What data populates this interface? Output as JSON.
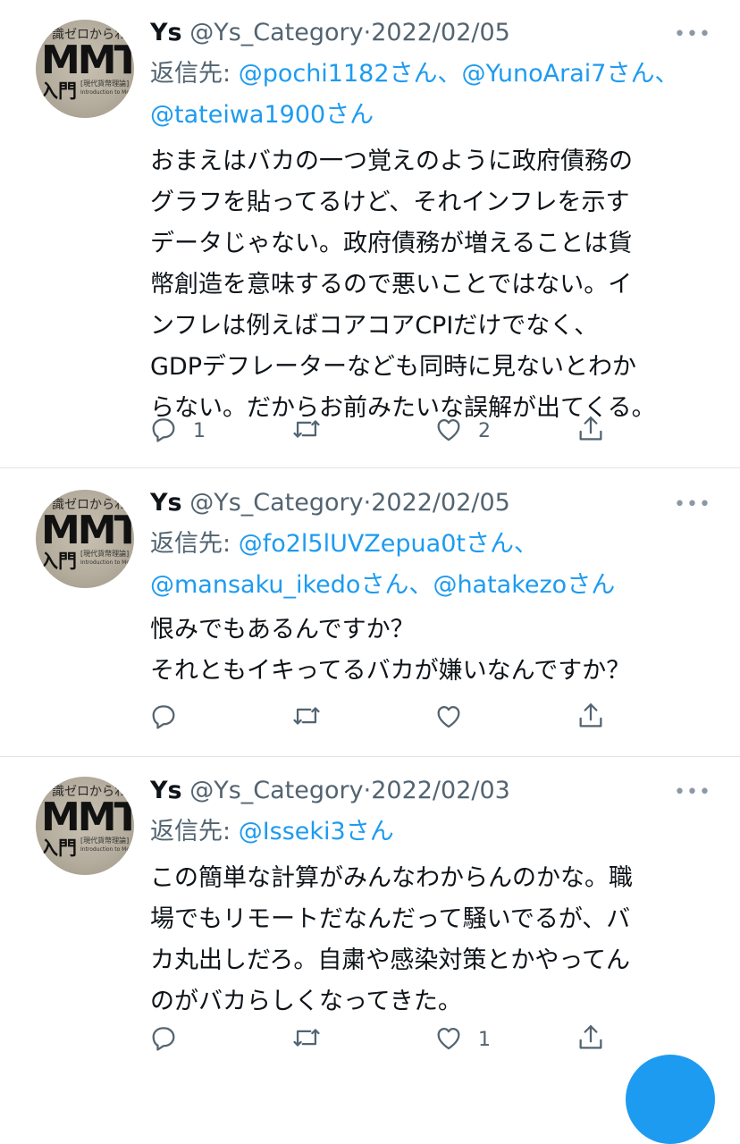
{
  "tweets": [
    {
      "name": "Ys",
      "handle": "@Ys_Category",
      "separator": "·",
      "date": "2022/02/05",
      "more": "•••",
      "reply_prefix": "返信先: ",
      "mentions": [
        "@pochi1182",
        "@YunoArai7",
        "@tateiwa1900"
      ],
      "mention_suffix": "さん",
      "body": "おまえはバカの一つ覚えのように政府債務の\nグラフを貼ってるけど、それインフレを示す\nデータじゃない。政府債務が増えることは貨\n幣創造を意味するので悪いことではない。イ\nンフレは例えばコアコアCPIだけでなく、\nGDPデフレーターなども同時に見ないとわか\nらない。だからお前みたいな誤解が出てくる。",
      "reply_count": "1",
      "retweet_count": "",
      "like_count": "2"
    },
    {
      "name": "Ys",
      "handle": "@Ys_Category",
      "separator": "·",
      "date": "2022/02/05",
      "more": "•••",
      "reply_prefix": "返信先: ",
      "mentions": [
        "@fo2l5lUVZepua0t",
        "@mansaku_ikedo",
        "@hatakezo"
      ],
      "mention_suffix": "さん",
      "body": "恨みでもあるんですか？\nそれともイキってるバカが嫌いなんですか？",
      "reply_count": "",
      "retweet_count": "",
      "like_count": ""
    },
    {
      "name": "Ys",
      "handle": "@Ys_Category",
      "separator": "·",
      "date": "2022/02/03",
      "more": "•••",
      "reply_prefix": "返信先: ",
      "mentions": [
        "@Isseki3"
      ],
      "mention_suffix": "さん",
      "body": "この簡単な計算がみんなわからんのかな。職\n場でもリモートだなんだって騒いでるが、バ\nカ丸出しだろ。自粛や感染対策とかやってん\nのがバカらしくなってきた。",
      "reply_count": "",
      "retweet_count": "",
      "like_count": "1"
    }
  ],
  "avatar": {
    "top_text": "識ゼロからわか",
    "title": "MMT",
    "subtitle": "入門",
    "series": "[現代貨幣理論]",
    "english": "Introduction to Modern Monetary Theory"
  },
  "icons": {
    "reply": "reply-icon",
    "retweet": "retweet-icon",
    "like": "heart-icon",
    "share": "share-icon"
  },
  "colors": {
    "link": "#1d9bf0",
    "secondary": "#536471",
    "text": "#0f1419",
    "divider": "#e1e4e8"
  }
}
